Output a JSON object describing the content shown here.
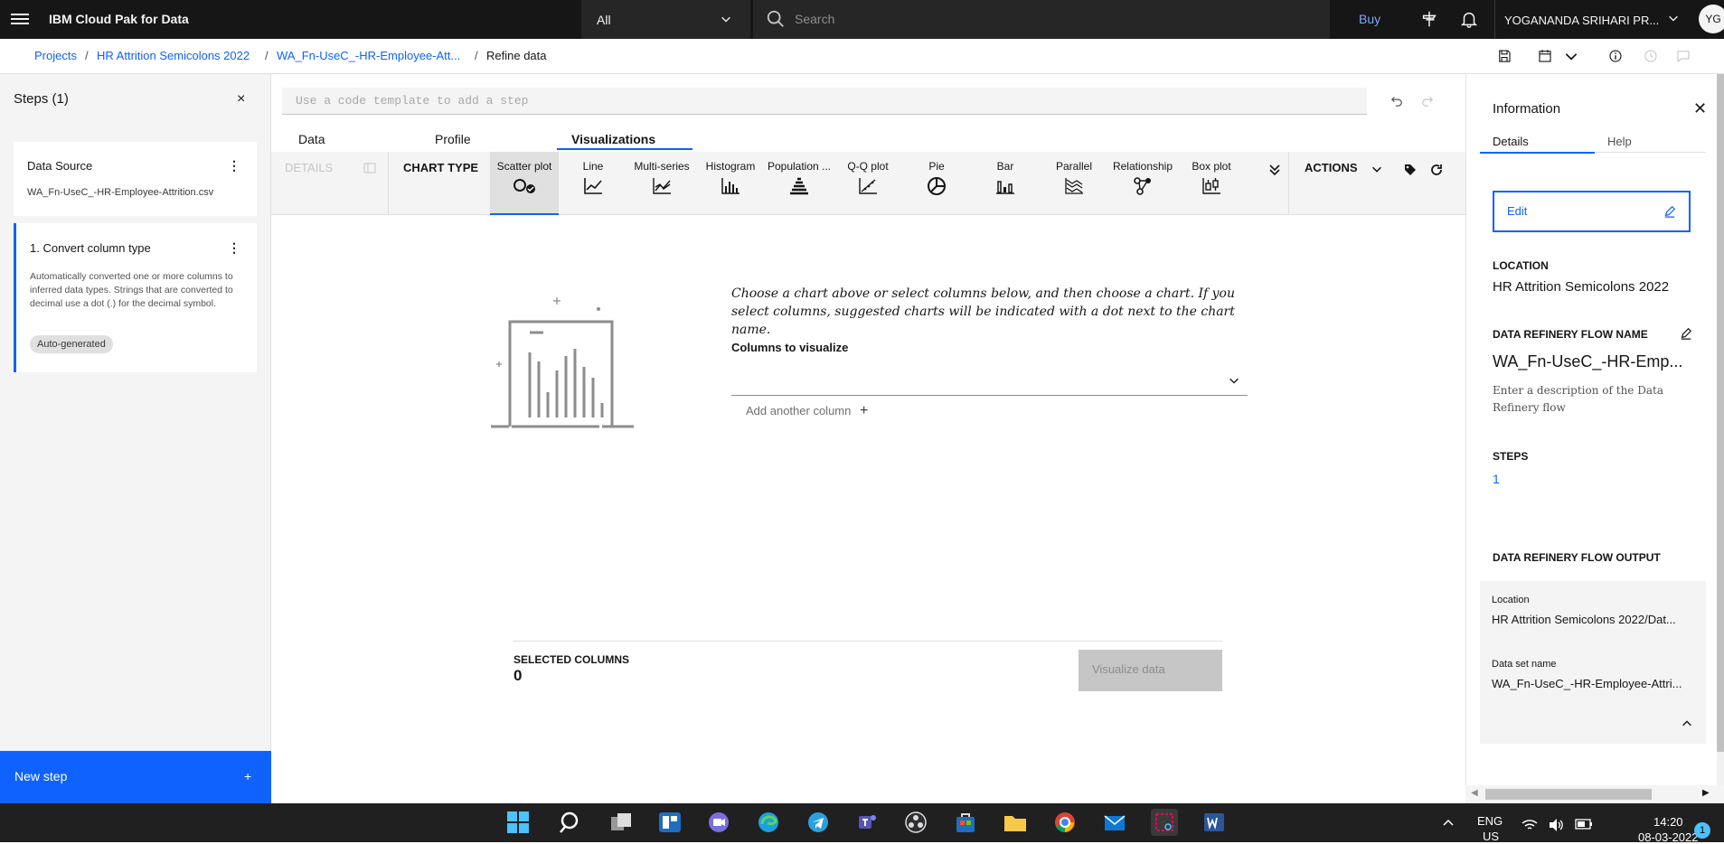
{
  "topbar": {
    "brand": "IBM Cloud Pak for Data",
    "scope": "All",
    "search_placeholder": "Search",
    "buy": "Buy",
    "user": "YOGANANDA SRIHARI PR...",
    "avatar": "YG"
  },
  "breadcrumbs": {
    "projects": "Projects",
    "project": "HR Attrition Semicolons 2022",
    "flow": "WA_Fn-UseC_-HR-Employee-Att...",
    "current": "Refine data",
    "sep": "/"
  },
  "steps": {
    "title": "Steps (1)",
    "close": "×",
    "source_title": "Data Source",
    "source_file": "WA_Fn-UseC_-HR-Employee-Attrition.csv",
    "step1_title": "1. Convert column type",
    "step1_desc": "Automatically converted one or more columns to inferred data types. Strings that are converted to decimal use a dot (.) for the decimal symbol.",
    "step1_tag": "Auto-generated",
    "new_step": "New step",
    "new_step_plus": "+"
  },
  "main": {
    "code_placeholder": "Use a code template to add a step",
    "tabs": [
      "Data",
      "Profile",
      "Visualizations"
    ],
    "details": "DETAILS",
    "chart_type": "CHART TYPE",
    "charts": [
      "Scatter plot",
      "Line",
      "Multi-series",
      "Histogram",
      "Population ...",
      "Q-Q plot",
      "Pie",
      "Bar",
      "Parallel",
      "Relationship",
      "Box plot"
    ],
    "actions": "ACTIONS",
    "hint": "Choose a chart above or select columns below, and then choose a chart. If you select columns, suggested charts will be indicated with a dot next to the chart name.",
    "columns_label": "Columns to visualize",
    "add_column": "Add another column",
    "selected_columns": "SELECTED COLUMNS",
    "selected_count": "0",
    "visualize": "Visualize data"
  },
  "info": {
    "title": "Information",
    "tabs": [
      "Details",
      "Help"
    ],
    "edit": "Edit",
    "location_label": "LOCATION",
    "location": "HR Attrition Semicolons 2022",
    "flow_name_label": "DATA REFINERY FLOW NAME",
    "flow_name": "WA_Fn-UseC_-HR-Emp...",
    "flow_desc": "Enter a description of the Data Refinery flow",
    "steps_label": "STEPS",
    "steps_value": "1",
    "output_label": "DATA REFINERY FLOW OUTPUT",
    "out_location_label": "Location",
    "out_location": "HR Attrition Semicolons 2022/Dat...",
    "out_dataset_label": "Data set name",
    "out_dataset": "WA_Fn-UseC_-HR-Employee-Attri..."
  },
  "taskbar": {
    "lang1": "ENG",
    "lang2": "US",
    "time": "14:20",
    "date": "08-03-2022",
    "notif": "1"
  },
  "colors": {
    "accent": "#0f62fe",
    "topbar": "#161616"
  }
}
